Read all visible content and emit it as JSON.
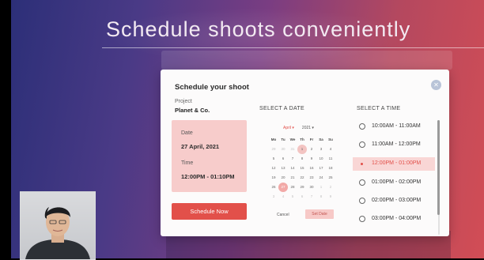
{
  "slide": {
    "title": "Schedule shoots conveniently"
  },
  "dialog": {
    "title": "Schedule your shoot",
    "close_icon": "✕",
    "project": {
      "label": "Project",
      "value": "Planet & Co."
    },
    "sections": {
      "date": "SELECT A DATE",
      "time": "SELECT A TIME"
    },
    "summary": {
      "date_label": "Date",
      "date_value": "27 April, 2021",
      "time_label": "Time",
      "time_value": "12:00PM - 01:10PM"
    },
    "schedule_button": "Schedule Now",
    "calendar": {
      "month": "April",
      "year": "2021",
      "weekdays": [
        "Mo",
        "Tu",
        "We",
        "Th",
        "Fr",
        "Sa",
        "Su"
      ],
      "rows": [
        [
          "29",
          "30",
          "31",
          "1",
          "2",
          "3",
          "4"
        ],
        [
          "5",
          "6",
          "7",
          "8",
          "9",
          "10",
          "11"
        ],
        [
          "12",
          "13",
          "14",
          "15",
          "16",
          "17",
          "18"
        ],
        [
          "19",
          "20",
          "21",
          "22",
          "23",
          "24",
          "25"
        ],
        [
          "26",
          "27",
          "28",
          "29",
          "30",
          "1",
          "2"
        ],
        [
          "3",
          "4",
          "5",
          "6",
          "7",
          "8",
          "9"
        ]
      ],
      "muted_cells": [
        [
          0,
          0
        ],
        [
          0,
          1
        ],
        [
          0,
          2
        ],
        [
          4,
          5
        ],
        [
          4,
          6
        ],
        [
          5,
          0
        ],
        [
          5,
          1
        ],
        [
          5,
          2
        ],
        [
          5,
          3
        ],
        [
          5,
          4
        ],
        [
          5,
          5
        ],
        [
          5,
          6
        ]
      ],
      "marked_cell": [
        0,
        3
      ],
      "selected_cell": [
        4,
        1
      ],
      "cancel_label": "Cancel",
      "set_label": "Set Date"
    },
    "time_slots": [
      {
        "label": "10:00AM - 11:00AM",
        "selected": false
      },
      {
        "label": "11:00AM - 12:00PM",
        "selected": false
      },
      {
        "label": "12:00PM - 01:00PM",
        "selected": true
      },
      {
        "label": "01:00PM - 02:00PM",
        "selected": false
      },
      {
        "label": "02:00PM - 03:00PM",
        "selected": false
      },
      {
        "label": "03:00PM - 04:00PM",
        "selected": false
      }
    ]
  },
  "colors": {
    "accent": "#e2504a",
    "summary_bg": "#f7cccb",
    "selected_slot_bg": "#f9d6d5"
  }
}
